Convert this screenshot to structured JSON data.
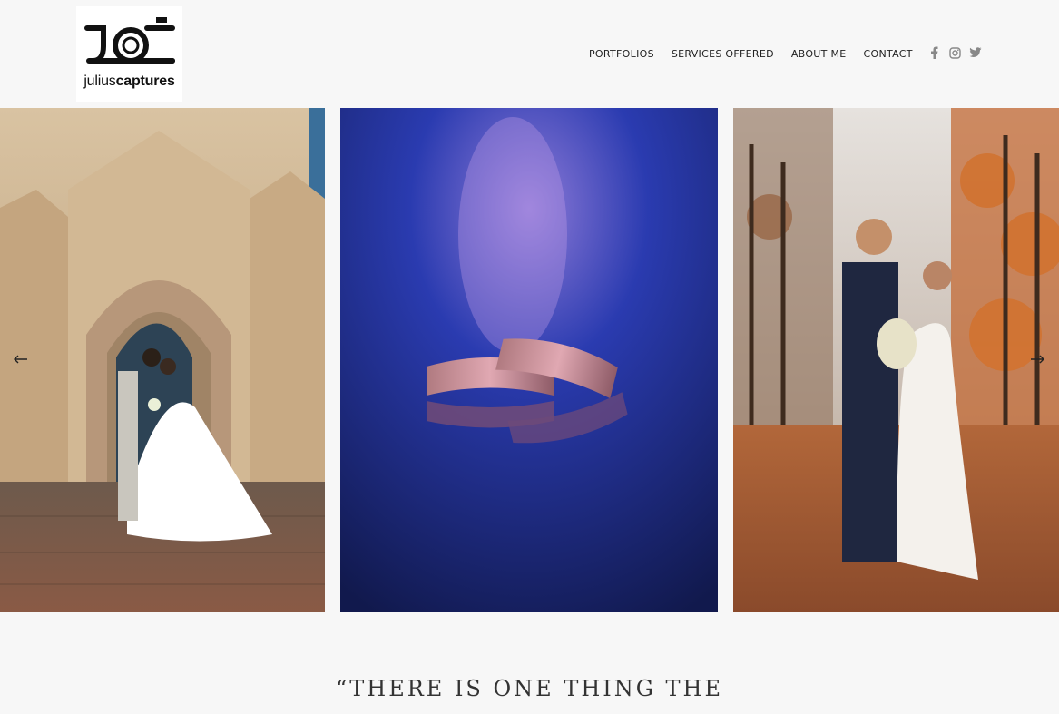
{
  "brand": {
    "name_light": "julius",
    "name_bold": "captures"
  },
  "nav": {
    "items": [
      {
        "label": "PORTFOLIOS"
      },
      {
        "label": "SERVICES OFFERED"
      },
      {
        "label": "ABOUT ME"
      },
      {
        "label": "CONTACT"
      }
    ]
  },
  "social": {
    "icons": [
      "facebook-icon",
      "instagram-icon",
      "twitter-icon"
    ]
  },
  "gallery": {
    "slides": [
      {
        "subject": "cathedral-couple-photo"
      },
      {
        "subject": "wedding-rings-photo"
      },
      {
        "subject": "autumn-couple-photo"
      }
    ],
    "prev_icon": "arrow-left-icon",
    "next_icon": "arrow-right-icon"
  },
  "quote": {
    "text": "“THERE IS ONE THING THE"
  },
  "colors": {
    "background": "#f7f7f7",
    "text": "#222222",
    "icon": "#888888"
  }
}
